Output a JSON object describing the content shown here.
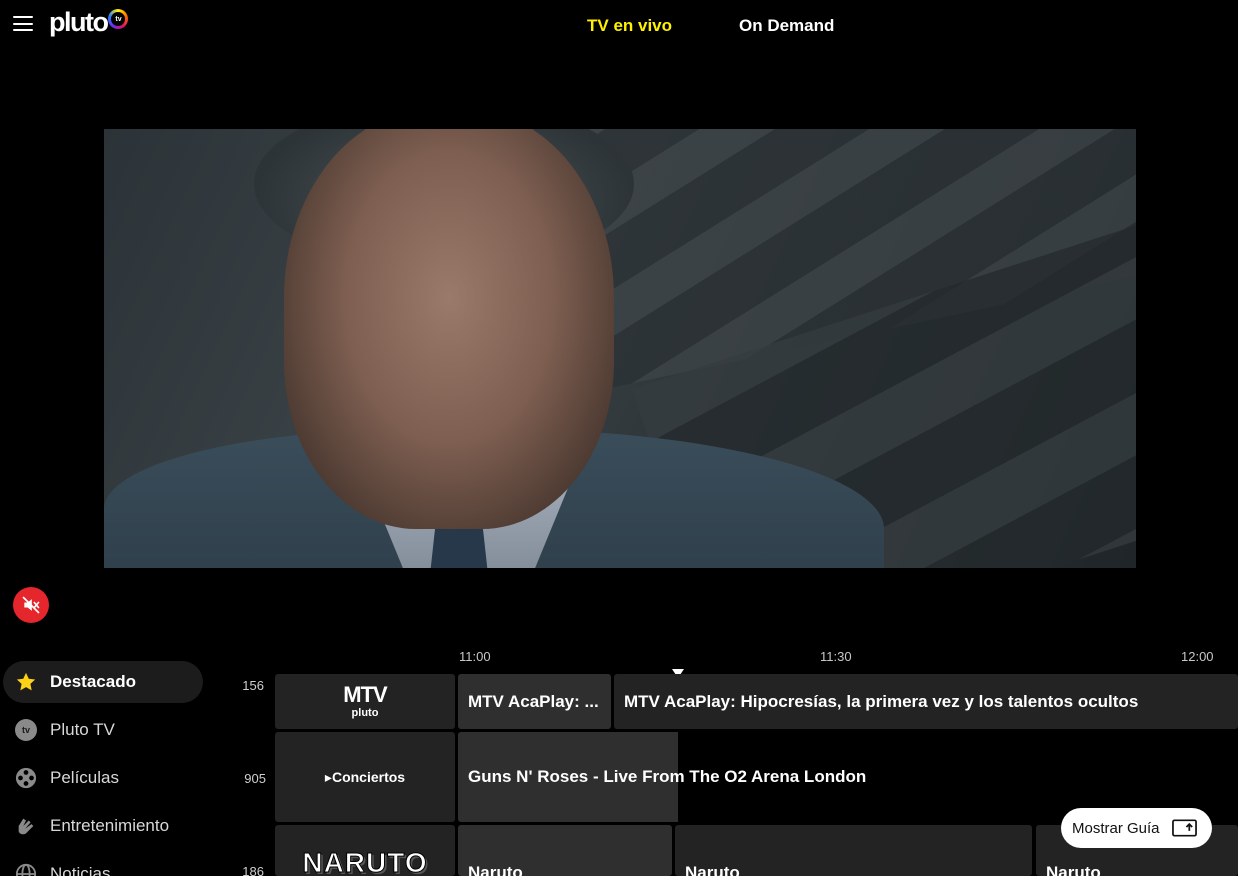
{
  "header": {
    "logo_text": "pluto",
    "logo_badge": "tv",
    "tabs": [
      {
        "label": "TV en vivo",
        "active": true
      },
      {
        "label": "On Demand",
        "active": false
      }
    ]
  },
  "player": {
    "muted": true
  },
  "timeline": {
    "times": [
      "11:00",
      "11:30",
      "12:00"
    ]
  },
  "categories": [
    {
      "label": "Destacado",
      "icon": "star-icon",
      "active": true
    },
    {
      "label": "Pluto TV",
      "icon": "pluto-tv-icon",
      "active": false
    },
    {
      "label": "Películas",
      "icon": "film-reel-icon",
      "active": false
    },
    {
      "label": "Entretenimiento",
      "icon": "clapping-hands-icon",
      "active": false
    },
    {
      "label": "Noticias",
      "icon": "globe-icon",
      "active": false
    }
  ],
  "channels": [
    {
      "number": "156",
      "logo_main": "MTV",
      "logo_sub": "pluto",
      "programs": [
        "MTV AcaPlay: ...",
        "MTV AcaPlay: Hipocresías, la primera vez y los talentos ocultos"
      ]
    },
    {
      "number": "905",
      "logo_main": "Conciertos",
      "programs": [
        "Guns N' Roses - Live From The O2 Arena London"
      ]
    },
    {
      "number": "186",
      "logo_main": "NARUTO",
      "programs": [
        "Naruto",
        "Naruto",
        "Naruto"
      ]
    }
  ],
  "guide_button": {
    "label": "Mostrar Guía"
  },
  "colors": {
    "accent": "#fff200",
    "mute": "#e5262d",
    "tile": "#232323"
  }
}
